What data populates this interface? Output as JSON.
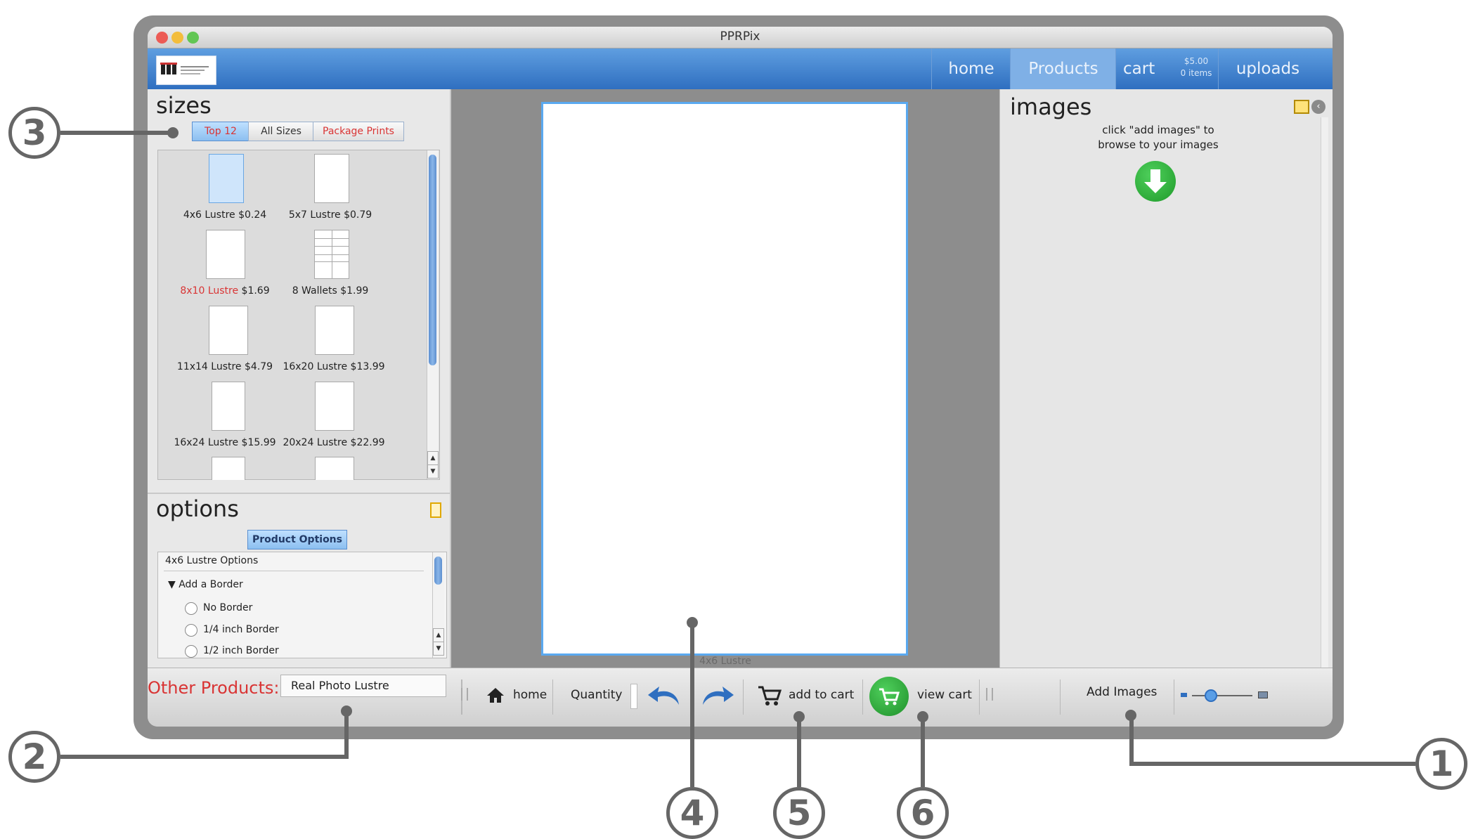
{
  "window": {
    "title": "PPRPix"
  },
  "nav": {
    "tabs": [
      {
        "label": "home"
      },
      {
        "label": "Products"
      },
      {
        "label": "cart"
      },
      {
        "label": "uploads"
      }
    ],
    "cart_total": "$5.00",
    "cart_items": "0 items",
    "active_tab": "Products"
  },
  "sizes": {
    "title": "sizes",
    "tabs": [
      "Top 12",
      "All Sizes",
      "Package Prints"
    ],
    "items": [
      {
        "name": "4x6 Lustre",
        "price": "$0.24",
        "selected": true
      },
      {
        "name": "5x7 Lustre",
        "price": "$0.79"
      },
      {
        "name": "8x10 Lustre",
        "price": "$1.69",
        "name_color": "#d93434"
      },
      {
        "name": "8 Wallets",
        "price": "$1.99"
      },
      {
        "name": "11x14 Lustre",
        "price": "$4.79"
      },
      {
        "name": "16x20 Lustre",
        "price": "$13.99"
      },
      {
        "name": "16x24 Lustre",
        "price": "$15.99"
      },
      {
        "name": "20x24 Lustre",
        "price": "$22.99"
      }
    ]
  },
  "options": {
    "title": "options",
    "tab": "Product Options",
    "section_title": "4x6 Lustre Options",
    "group": "Add a Border",
    "choices": [
      "No Border",
      "1/4 inch Border",
      "1/2 inch Border"
    ]
  },
  "canvas": {
    "caption": "4x6 Lustre"
  },
  "images": {
    "title": "images",
    "hint_line1": "click \"add images\" to",
    "hint_line2": "browse to your images"
  },
  "bottombar": {
    "other_products_label": "Other Products:",
    "other_products_value": "Real Photo Lustre",
    "home": "home",
    "quantity": "Quantity",
    "add_to_cart": "add to cart",
    "view_cart": "view cart",
    "add_images": "Add Images",
    "zoom_level": 0.25
  },
  "callouts": [
    "1",
    "2",
    "3",
    "4",
    "5",
    "6"
  ],
  "colors": {
    "nav_blue": "#2f6fc0",
    "accent_red": "#d93434",
    "green": "#1f9a2a",
    "selection": "#5aa9f0"
  }
}
